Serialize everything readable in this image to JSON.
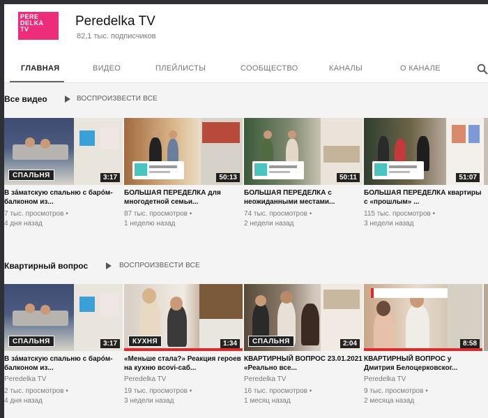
{
  "channel": {
    "name": "Peredelka TV",
    "subscribers": "82,1 тыс. подписчиков",
    "logo_lines": [
      "PERE",
      "DELKA",
      "TV"
    ],
    "brand_color": "#ee2d7a"
  },
  "tabs": [
    {
      "label": "ГЛАВНАЯ",
      "active": true
    },
    {
      "label": "ВИДЕО"
    },
    {
      "label": "ПЛЕЙЛИСТЫ"
    },
    {
      "label": "СООБЩЕСТВО"
    },
    {
      "label": "КАНАЛЫ"
    },
    {
      "label": "О КАНАЛЕ"
    }
  ],
  "shelves": [
    {
      "title": "Все видео",
      "play_all": "ВОСПРОИЗВЕСТИ ВСЕ",
      "videos": [
        {
          "title": "В зáматскую спальню с барóм-балконом из...",
          "channel": "",
          "views": "7 тыс. просмотров •",
          "age": "4 дня назад",
          "duration": "3:17",
          "banner": "СПАЛЬНЯ"
        },
        {
          "title": "БОЛЬШАЯ ПЕРЕДЕЛКА для многодетной семьи...",
          "channel": "",
          "views": "87 тыс. просмотров •",
          "age": "1 неделю назад",
          "duration": "50:13"
        },
        {
          "title": "БОЛЬШАЯ ПЕРЕДЕЛКА с неожиданными местами...",
          "channel": "",
          "views": "74 тыс. просмотров •",
          "age": "2 недели назад",
          "duration": "50:11"
        },
        {
          "title": "БОЛЬШАЯ ПЕРЕДЕЛКА квартиры с «прошлым» ...",
          "channel": "",
          "views": "115 тыс. просмотров •",
          "age": "3 недели назад",
          "duration": "51:07"
        }
      ]
    },
    {
      "title": "Квартирный вопрос",
      "play_all": "ВОСПРОИЗВЕСТИ ВСЕ",
      "videos": [
        {
          "title": "В зáматскую спальню с барóм-балконом из...",
          "channel": "Peredelka TV",
          "views": "2 тыс. просмотров •",
          "age": "4 дня назад",
          "duration": "3:17",
          "banner": "СПАЛЬНЯ"
        },
        {
          "title": "«Меньше стала?» Реакция героев на кухню вcovi-саб...",
          "channel": "Peredelka TV",
          "views": "19 тыс. просмотров •",
          "age": "3 недели назад",
          "duration": "1:34",
          "banner": "КУХНЯ"
        },
        {
          "title": "КВАРТИРНЫЙ ВОПРОС 23.01.2021 «Реально все...",
          "channel": "Peredelka TV",
          "views": "16 тыс. просмотров •",
          "age": "1 месяц назад",
          "duration": "2:04",
          "banner": "СПАЛЬНЯ"
        },
        {
          "title": "КВАРТИРНЫЙ ВОПРОС у Дмитрия Белоцерковског...",
          "channel": "Peredelka TV",
          "views": "9 тыс. просмотров •",
          "age": "2 месяца назад",
          "duration": "8:58"
        }
      ]
    }
  ]
}
